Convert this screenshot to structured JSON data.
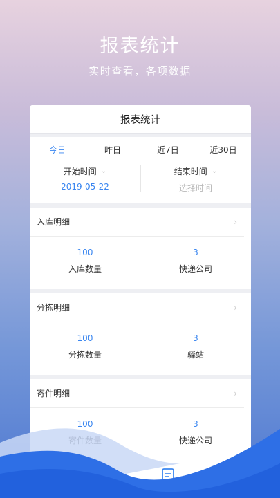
{
  "hero": {
    "title": "报表统计",
    "subtitle": "实时查看，各项数据"
  },
  "screen": {
    "nav_title": "报表统计",
    "range_tabs": [
      {
        "label": "今日",
        "active": true
      },
      {
        "label": "昨日",
        "active": false
      },
      {
        "label": "近7日",
        "active": false
      },
      {
        "label": "近30日",
        "active": false
      }
    ],
    "start": {
      "label": "开始时间",
      "value": "2019-05-22"
    },
    "end": {
      "label": "结束时间",
      "placeholder": "选择时间"
    },
    "sections": [
      {
        "title": "入库明细",
        "stats": [
          {
            "value": "100",
            "label": "入库数量"
          },
          {
            "value": "3",
            "label": "快递公司"
          }
        ]
      },
      {
        "title": "分拣明细",
        "stats": [
          {
            "value": "100",
            "label": "分拣数量"
          },
          {
            "value": "3",
            "label": "驿站"
          }
        ]
      },
      {
        "title": "寄件明细",
        "stats": [
          {
            "value": "100",
            "label": "寄件数量"
          },
          {
            "value": "3",
            "label": "快递公司"
          }
        ]
      }
    ],
    "tabbar_icons": [
      "report-icon",
      "user-icon"
    ]
  },
  "colors": {
    "accent": "#3a86f0",
    "background_top": "#e7d2df",
    "background_bottom": "#4d78d2"
  }
}
